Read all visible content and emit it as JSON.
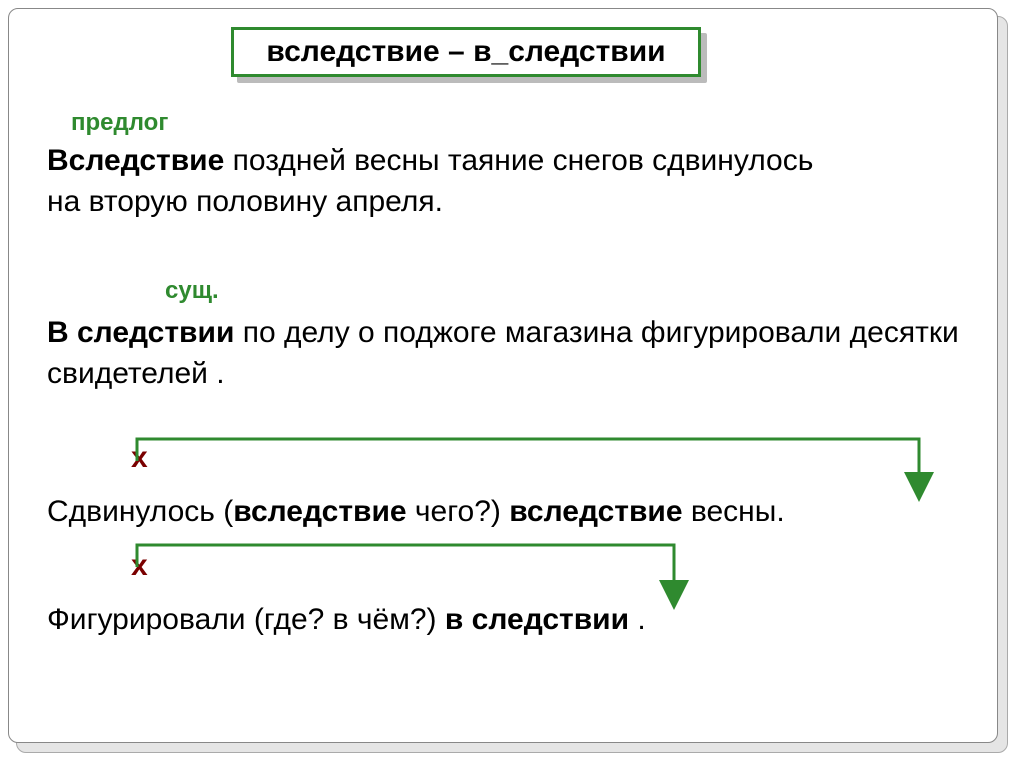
{
  "title": "вследствие – в_следствии",
  "labels": {
    "predlog": "предлог",
    "sush": "сущ."
  },
  "para1": {
    "line1_pre": "",
    "line1_b": "Вследствие",
    "line1_post": " поздней весны таяние снегов сдвинулось",
    "line2": "на вторую половину апреля."
  },
  "para2": {
    "line1_pre": "",
    "line1_b": "В следствии",
    "line1_post": " по делу о поджоге магазина фигурировали десятки свидетелей ."
  },
  "x": "х",
  "row1": {
    "w1": "Сдвинулось (",
    "w2_b": "вследствие",
    "w3": " чего?) ",
    "w4_b": "вследствие",
    "w5": " весны."
  },
  "row2": {
    "w1": "Фигурировали  (где? в чём?) ",
    "w2_b": "в следствии",
    "w3": " ."
  }
}
